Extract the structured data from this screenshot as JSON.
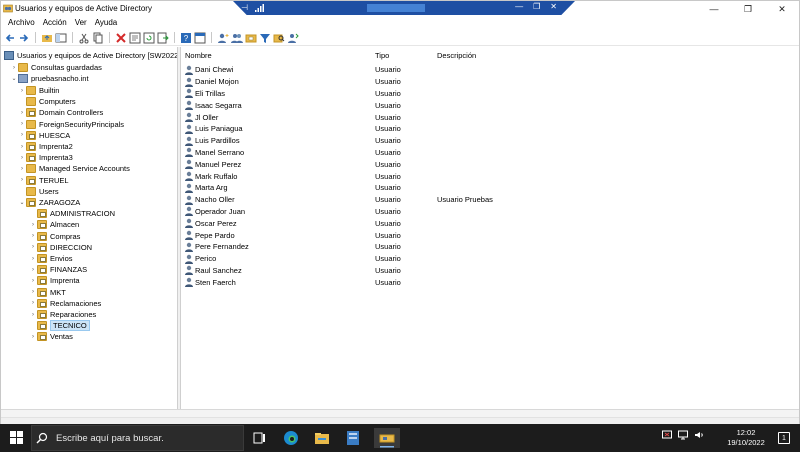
{
  "window": {
    "title": "Usuarios y equipos de Active Directory",
    "controls": {
      "minimize": "—",
      "restore": "❐",
      "close": "✕"
    }
  },
  "rdp_bar": {
    "pin": "⊣",
    "minimize": "—",
    "restore": "❐",
    "close": "✕"
  },
  "menu": [
    "Archivo",
    "Acción",
    "Ver",
    "Ayuda"
  ],
  "tree": {
    "root": "Usuarios y equipos de Active Directory [SW2022N",
    "saved_queries": "Consultas guardadas",
    "domain": "pruebasnacho.int",
    "domain_children": [
      {
        "label": "Builtin",
        "type": "container",
        "expandable": true
      },
      {
        "label": "Computers",
        "type": "container",
        "expandable": false
      },
      {
        "label": "Domain Controllers",
        "type": "ou",
        "expandable": true
      },
      {
        "label": "ForeignSecurityPrincipals",
        "type": "container",
        "expandable": true
      },
      {
        "label": "HUESCA",
        "type": "ou",
        "expandable": true
      },
      {
        "label": "Imprenta2",
        "type": "ou",
        "expandable": true
      },
      {
        "label": "Imprenta3",
        "type": "ou",
        "expandable": true
      },
      {
        "label": "Managed Service Accounts",
        "type": "container",
        "expandable": true
      },
      {
        "label": "TERUEL",
        "type": "ou",
        "expandable": true
      },
      {
        "label": "Users",
        "type": "container",
        "expandable": false
      },
      {
        "label": "ZARAGOZA",
        "type": "ou",
        "expandable": true,
        "expanded": true
      }
    ],
    "zaragoza_children": [
      {
        "label": "ADMINISTRACION",
        "expandable": false
      },
      {
        "label": "Almacen",
        "expandable": true
      },
      {
        "label": "Compras",
        "expandable": true
      },
      {
        "label": "DIRECCION",
        "expandable": true
      },
      {
        "label": "Envios",
        "expandable": true
      },
      {
        "label": "FINANZAS",
        "expandable": true
      },
      {
        "label": "Imprenta",
        "expandable": true
      },
      {
        "label": "MKT",
        "expandable": true
      },
      {
        "label": "Reclamaciones",
        "expandable": true
      },
      {
        "label": "Reparaciones",
        "expandable": true
      },
      {
        "label": "TECNICO",
        "expandable": false,
        "selected": true
      },
      {
        "label": "Ventas",
        "expandable": true
      }
    ]
  },
  "list": {
    "columns": {
      "name": "Nombre",
      "type": "Tipo",
      "description": "Descripción"
    },
    "rows": [
      {
        "name": "Dani Chewi",
        "type": "Usuario",
        "description": ""
      },
      {
        "name": "Daniel Mojon",
        "type": "Usuario",
        "description": ""
      },
      {
        "name": "Eli Trillas",
        "type": "Usuario",
        "description": ""
      },
      {
        "name": "Isaac Segarra",
        "type": "Usuario",
        "description": ""
      },
      {
        "name": "Jl Oller",
        "type": "Usuario",
        "description": ""
      },
      {
        "name": "Luis Paniagua",
        "type": "Usuario",
        "description": ""
      },
      {
        "name": "Luis Pardillos",
        "type": "Usuario",
        "description": ""
      },
      {
        "name": "Manel Serrano",
        "type": "Usuario",
        "description": ""
      },
      {
        "name": "Manuel Perez",
        "type": "Usuario",
        "description": ""
      },
      {
        "name": "Mark Ruffalo",
        "type": "Usuario",
        "description": ""
      },
      {
        "name": "Marta Arg",
        "type": "Usuario",
        "description": ""
      },
      {
        "name": "Nacho Oller",
        "type": "Usuario",
        "description": "Usuario Pruebas"
      },
      {
        "name": "Operador Juan",
        "type": "Usuario",
        "description": ""
      },
      {
        "name": "Oscar Perez",
        "type": "Usuario",
        "description": ""
      },
      {
        "name": "Pepe Pardo",
        "type": "Usuario",
        "description": ""
      },
      {
        "name": "Pere Fernandez",
        "type": "Usuario",
        "description": ""
      },
      {
        "name": "Perico",
        "type": "Usuario",
        "description": ""
      },
      {
        "name": "Raul Sanchez",
        "type": "Usuario",
        "description": ""
      },
      {
        "name": "Sten Faerch",
        "type": "Usuario",
        "description": ""
      }
    ]
  },
  "taskbar": {
    "search_placeholder": "Escribe aquí para buscar.",
    "time": "12:02",
    "date": "19/10/2022",
    "notification_count": "1"
  },
  "colors": {
    "taskbar_bg": "#1c1c1c",
    "rdp_bar": "#1e4fa3",
    "selection": "#cce4f7",
    "folder": "#e8b94a"
  }
}
